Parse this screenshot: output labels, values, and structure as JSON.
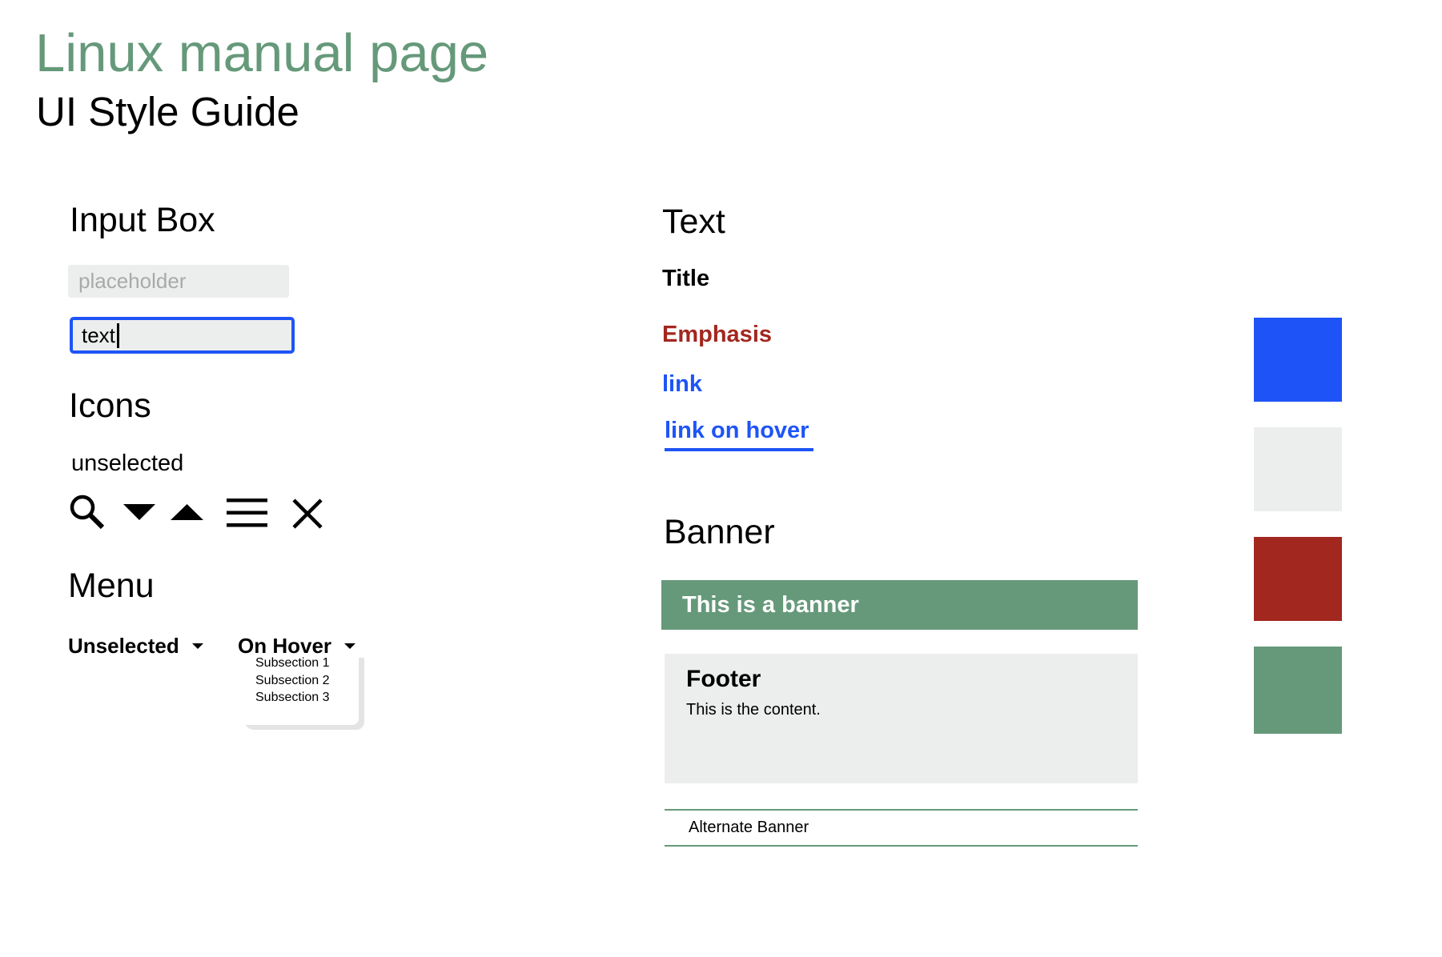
{
  "header": {
    "title": "Linux manual page",
    "subtitle": "UI Style Guide"
  },
  "input_section": {
    "heading": "Input Box",
    "placeholder": "placeholder",
    "value": "text"
  },
  "icons_section": {
    "heading": "Icons",
    "state_label": "unselected",
    "icons": [
      "search-icon",
      "caret-down-icon",
      "caret-up-icon",
      "hamburger-menu-icon",
      "close-icon"
    ]
  },
  "menu_section": {
    "heading": "Menu",
    "unselected_label": "Unselected",
    "hover_label": "On Hover",
    "subsections": [
      "Subsection 1",
      "Subsection 2",
      "Subsection 3"
    ]
  },
  "text_section": {
    "heading": "Text",
    "title_sample": "Title",
    "emphasis_sample": "Emphasis",
    "link_sample": "link",
    "link_hover_sample": "link on hover"
  },
  "banner_section": {
    "heading": "Banner",
    "banner_text": "This is a banner",
    "footer_title": "Footer",
    "footer_content": "This is the content.",
    "alternate_banner_text": "Alternate Banner"
  },
  "palette": {
    "blue": "#1e54f7",
    "light_gray": "#eceeed",
    "red": "#a2271f",
    "green": "#65997a"
  }
}
